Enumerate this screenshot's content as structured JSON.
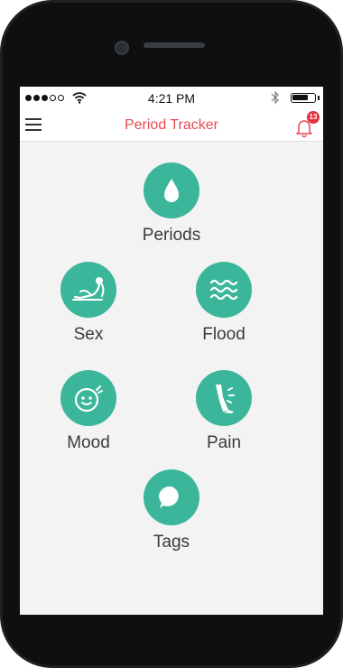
{
  "status": {
    "time": "4:21 PM",
    "battery_level": 0.75
  },
  "header": {
    "title": "Period Tracker",
    "notifications_count": "13"
  },
  "trackers": [
    {
      "label": "Periods",
      "icon": "drop-icon"
    },
    {
      "label": "Sex",
      "icon": "reclining-figure-icon"
    },
    {
      "label": "Flood",
      "icon": "waves-icon"
    },
    {
      "label": "Mood",
      "icon": "smiley-icon"
    },
    {
      "label": "Pain",
      "icon": "leg-pain-icon"
    },
    {
      "label": "Tags",
      "icon": "speech-bubble-icon"
    }
  ],
  "colors": {
    "accent": "#3bb69a",
    "title": "#e9494f",
    "badge": "#e0333b"
  }
}
